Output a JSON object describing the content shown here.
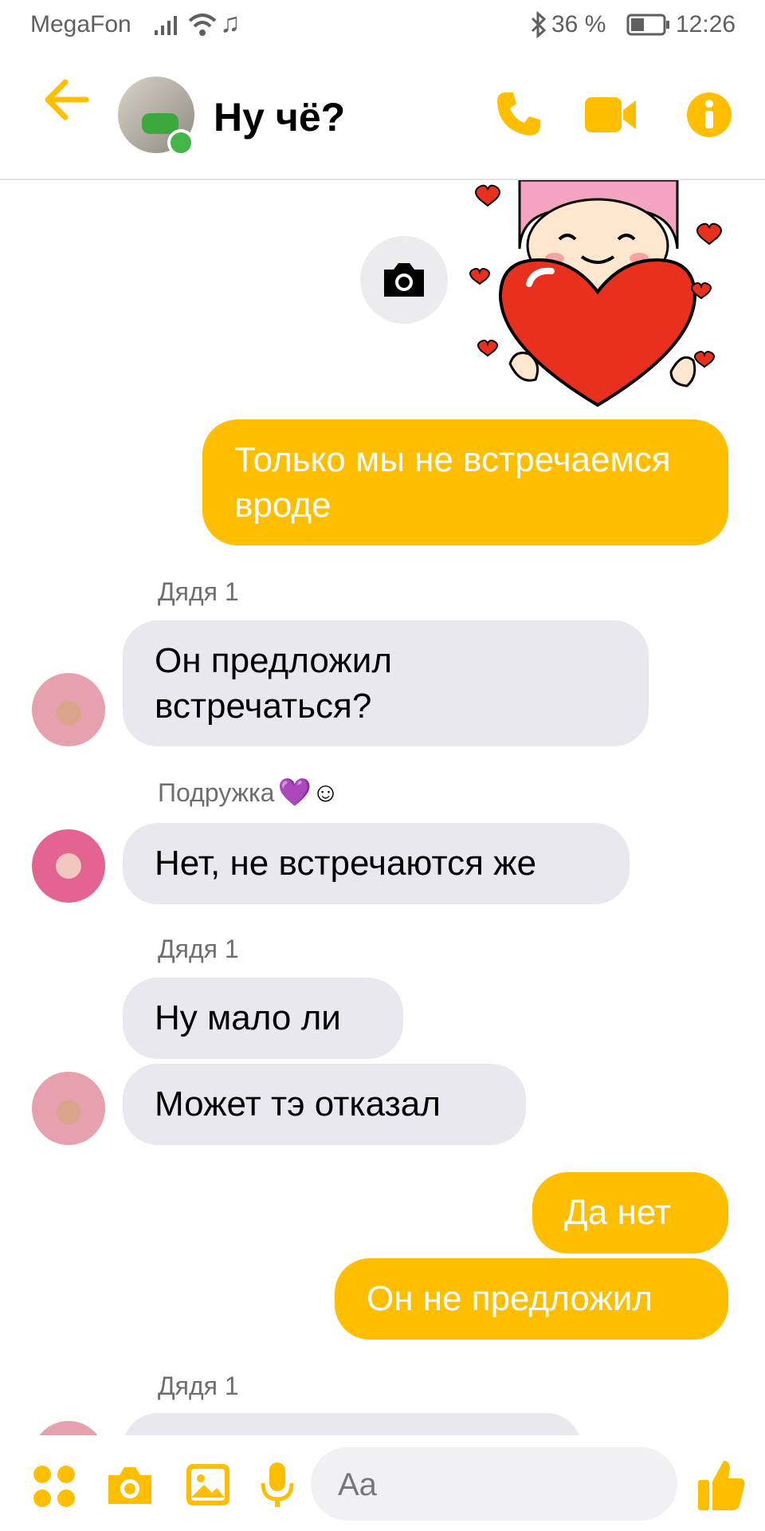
{
  "status_bar": {
    "carrier": "MegaFon",
    "battery_percent": "36 %",
    "time": "12:26"
  },
  "header": {
    "title": "Ну чё?"
  },
  "colors": {
    "accent": "#ffbe00",
    "incoming_bubble": "#e9e8ee",
    "online": "#44b549"
  },
  "messages": [
    {
      "text": "Только мы не встречаемся вроде"
    },
    {
      "sender": "Дядя 1",
      "text": "Он предложил встречаться?"
    },
    {
      "sender": "Подружка",
      "sender_emoji": "💜☺",
      "text": "Нет, не встречаются же"
    },
    {
      "sender": "Дядя 1",
      "text": "Ну мало ли"
    },
    {
      "text": "Может тэ отказал"
    },
    {
      "text": "Да нет"
    },
    {
      "text": "Он не предложил"
    },
    {
      "sender": "Дядя 1"
    }
  ],
  "composer": {
    "placeholder": "Aa"
  },
  "icons": [
    "back-arrow-icon",
    "phone-icon",
    "video-camera-icon",
    "info-icon",
    "camera-icon",
    "apps-icon",
    "photo-camera-icon",
    "gallery-icon",
    "microphone-icon",
    "emoji-icon",
    "thumbs-up-icon"
  ]
}
